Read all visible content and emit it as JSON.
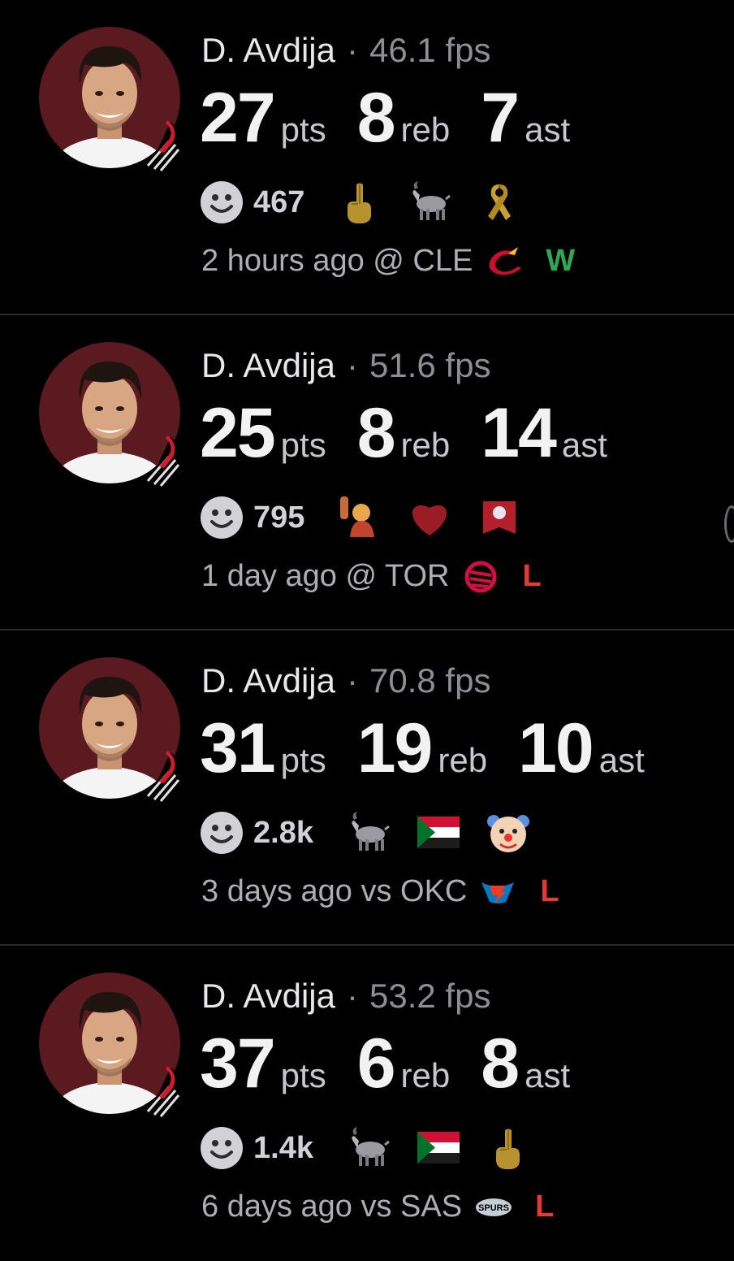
{
  "colors": {
    "background": "#000000",
    "win": "#2fa84f",
    "loss": "#e53935",
    "avatar_bg": "#5a1a20"
  },
  "games": [
    {
      "player": "D. Avdija",
      "separator": "·",
      "fps": "46.1 fps",
      "pts": "27",
      "pts_label": "pts",
      "reb": "8",
      "reb_label": "reb",
      "ast": "7",
      "ast_label": "ast",
      "reaction_icon": "smile-icon",
      "reaction_count": "467",
      "emojis": [
        "middle-finger-icon",
        "goat-icon",
        "ribbon-icon"
      ],
      "when": "2 hours ago @ CLE",
      "opponent_logo": "cavaliers-logo-icon",
      "result": "W"
    },
    {
      "player": "D. Avdija",
      "separator": "·",
      "fps": "51.6 fps",
      "pts": "25",
      "pts_label": "pts",
      "reb": "8",
      "reb_label": "reb",
      "ast": "14",
      "ast_label": "ast",
      "reaction_icon": "smile-icon",
      "reaction_count": "795",
      "emojis": [
        "person-raising-hand-icon",
        "heart-icon",
        "flag-icon"
      ],
      "when": "1 day ago @ TOR",
      "opponent_logo": "raptors-logo-icon",
      "result": "L"
    },
    {
      "player": "D. Avdija",
      "separator": "·",
      "fps": "70.8 fps",
      "pts": "31",
      "pts_label": "pts",
      "reb": "19",
      "reb_label": "reb",
      "ast": "10",
      "ast_label": "ast",
      "reaction_icon": "smile-icon",
      "reaction_count": "2.8k",
      "emojis": [
        "goat-icon",
        "sudan-flag-icon",
        "clown-face-icon"
      ],
      "when": "3 days ago vs OKC",
      "opponent_logo": "thunder-logo-icon",
      "result": "L"
    },
    {
      "player": "D. Avdija",
      "separator": "·",
      "fps": "53.2 fps",
      "pts": "37",
      "pts_label": "pts",
      "reb": "6",
      "reb_label": "reb",
      "ast": "8",
      "ast_label": "ast",
      "reaction_icon": "smile-icon",
      "reaction_count": "1.4k",
      "emojis": [
        "goat-icon",
        "sudan-flag-icon",
        "middle-finger-icon"
      ],
      "when": "6 days ago vs SAS",
      "opponent_logo": "spurs-logo-icon",
      "result": "L"
    }
  ]
}
